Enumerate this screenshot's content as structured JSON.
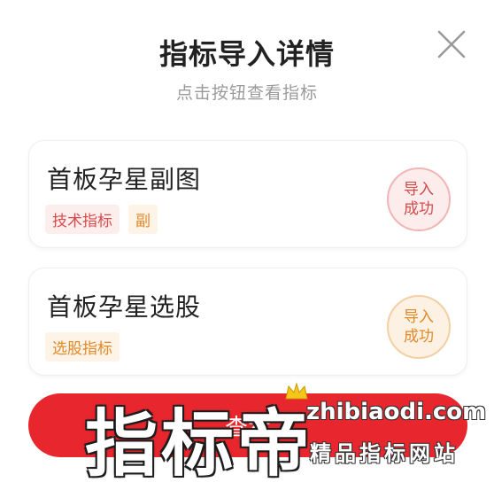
{
  "dialog": {
    "title": "指标导入详情",
    "subtitle": "点击按钮查看指标",
    "close_icon": "close-icon"
  },
  "items": [
    {
      "name": "首板孕星副图",
      "tags": [
        "技术指标",
        "副"
      ],
      "status": [
        "导入",
        "成功"
      ],
      "status_color": "#d24a4a"
    },
    {
      "name": "首板孕星选股",
      "tags": [
        "选股指标"
      ],
      "status": [
        "导入",
        "成功"
      ],
      "status_color": "#e08a2a"
    }
  ],
  "button": {
    "label": "查看",
    "color": "#e8262d"
  },
  "watermark": {
    "big": "指标帝",
    "site": "zhibiaodi.com",
    "slogan": "精品指标网站",
    "crown_icon": "crown-icon"
  }
}
